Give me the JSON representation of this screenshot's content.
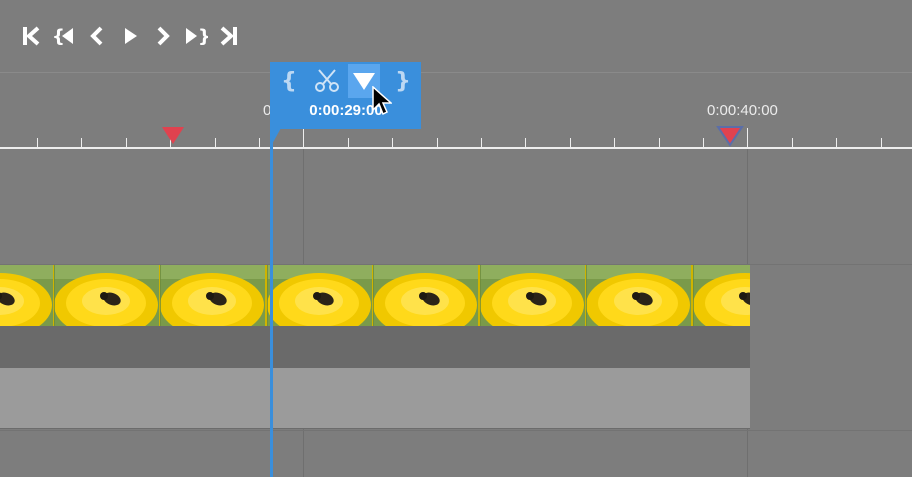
{
  "transport": {
    "buttons": [
      {
        "name": "go-to-start-button",
        "icon": "skip-start-icon"
      },
      {
        "name": "previous-marker-button",
        "icon": "brace-prev-icon"
      },
      {
        "name": "previous-frame-button",
        "icon": "chevron-left-icon"
      },
      {
        "name": "play-button",
        "icon": "play-icon"
      },
      {
        "name": "next-frame-button",
        "icon": "chevron-right-icon"
      },
      {
        "name": "next-marker-button",
        "icon": "brace-next-icon"
      },
      {
        "name": "go-to-end-button",
        "icon": "skip-end-icon"
      }
    ]
  },
  "ruler": {
    "label_left_partial": "0",
    "label_right": "0:00:40:00"
  },
  "popup": {
    "timecode": "0:00:29:00",
    "buttons": [
      {
        "name": "set-in-point-button",
        "icon": "brace-open-icon",
        "glyph": "{"
      },
      {
        "name": "split-button",
        "icon": "scissors-icon"
      },
      {
        "name": "add-marker-button",
        "icon": "marker-triangle-icon"
      },
      {
        "name": "set-out-point-button",
        "icon": "brace-close-icon",
        "glyph": "}"
      }
    ]
  },
  "colors": {
    "accent": "#3a8fdc",
    "accent_active": "#5aa6ee",
    "marker": "#e0424f",
    "background": "#7d7d7d"
  }
}
